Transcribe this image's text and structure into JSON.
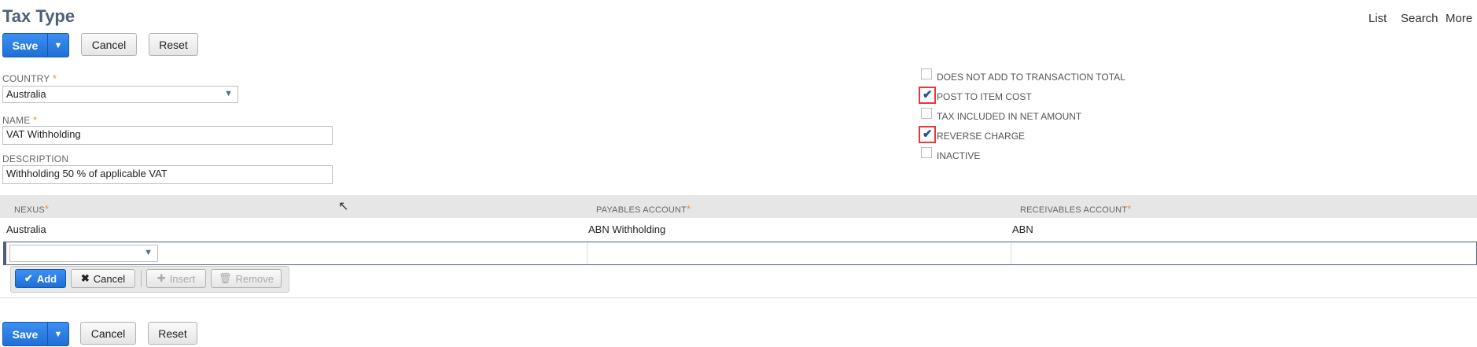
{
  "page": {
    "title": "Tax Type",
    "nav": {
      "list": "List",
      "search": "Search",
      "more": "More"
    }
  },
  "toolbar": {
    "save": "Save",
    "cancel": "Cancel",
    "reset": "Reset",
    "save_menu_icon": "caret-down-icon"
  },
  "form": {
    "country": {
      "label": "COUNTRY",
      "required": "*",
      "value": "Australia"
    },
    "name": {
      "label": "NAME",
      "required": "*",
      "value": "VAT Withholding"
    },
    "description": {
      "label": "DESCRIPTION",
      "value": "Withholding 50 % of applicable VAT"
    }
  },
  "checkboxes": [
    {
      "label": "DOES NOT ADD TO TRANSACTION TOTAL",
      "checked": false
    },
    {
      "label": "POST TO ITEM COST",
      "checked": true,
      "highlighted": true
    },
    {
      "label": "TAX INCLUDED IN NET AMOUNT",
      "checked": false
    },
    {
      "label": "REVERSE CHARGE",
      "checked": true,
      "highlighted": true
    },
    {
      "label": "INACTIVE",
      "checked": false
    }
  ],
  "table": {
    "columns": [
      {
        "label": "NEXUS",
        "required": "*"
      },
      {
        "label": "PAYABLES ACCOUNT",
        "required": "*"
      },
      {
        "label": "RECEIVABLES ACCOUNT",
        "required": "*"
      }
    ],
    "rows": [
      {
        "nexus": "Australia",
        "payables": "ABN Withholding",
        "receivables": "ABN"
      }
    ],
    "actions": {
      "add": "Add",
      "cancel": "Cancel",
      "insert": "Insert",
      "remove": "Remove"
    }
  },
  "colors": {
    "accent": "#1f6fd6",
    "title": "#4d5f79",
    "required": "#f0912b",
    "highlight": "#e03a3a"
  }
}
